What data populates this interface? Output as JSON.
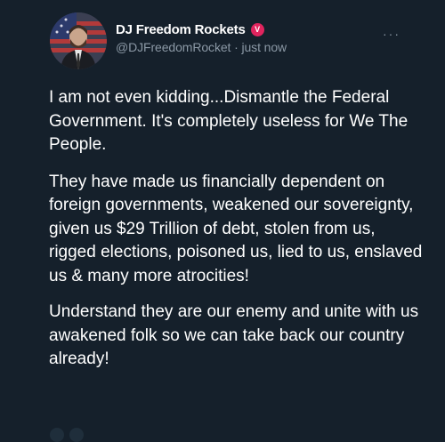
{
  "tweet": {
    "author": {
      "display_name": "DJ Freedom Rockets",
      "badge_icon": "verified-badge-icon",
      "badge_symbol": "V",
      "handle": "@DJFreedomRocket",
      "separator": " · ",
      "timestamp": "just now"
    },
    "more_icon": "more-horizontal-icon",
    "more_symbol": "···",
    "paragraphs": [
      "I am not even kidding...Dismantle the Federal Government. It's completely useless for We The People.",
      "They have made us financially dependent on foreign governments, weakened our sovereignty, given us $29 Trillion of debt, stolen from us, rigged elections, poisoned us, lied to us, enslaved us & many more atrocities!",
      "Understand they are our enemy and unite with us awakened folk so we can take back our country already!"
    ]
  },
  "colors": {
    "background": "#15202b",
    "text": "#ffffff",
    "secondary": "#8b98a5",
    "badge": "#e0245e"
  }
}
